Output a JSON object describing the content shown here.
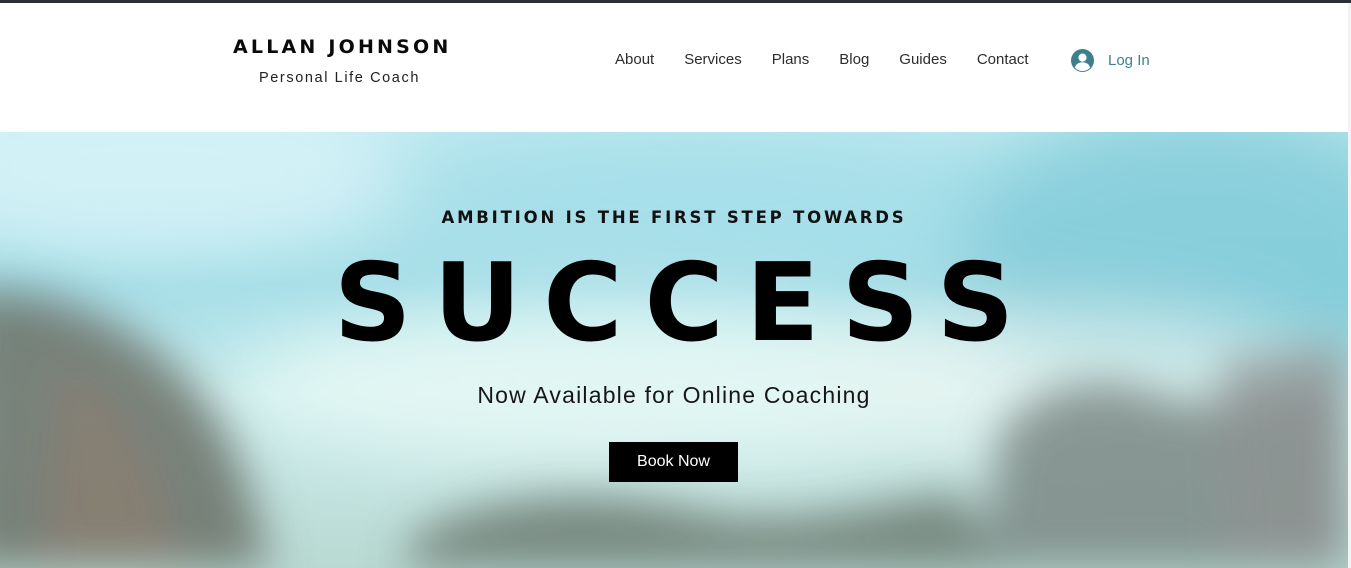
{
  "header": {
    "brand_name": "ALLAN JOHNSON",
    "brand_tagline": "Personal Life Coach"
  },
  "nav": {
    "items": [
      {
        "label": "About"
      },
      {
        "label": "Services"
      },
      {
        "label": "Plans"
      },
      {
        "label": "Blog"
      },
      {
        "label": "Guides"
      },
      {
        "label": "Contact"
      }
    ]
  },
  "login": {
    "label": "Log In",
    "icon": "user-avatar-icon"
  },
  "hero": {
    "eyebrow": "AMBITION IS THE FIRST STEP TOWARDS",
    "title": "SUCCESS",
    "subtitle": "Now Available for Online Coaching",
    "cta_label": "Book Now"
  },
  "colors": {
    "accent": "#3d7f8f",
    "button_bg": "#000000",
    "top_strip": "#2c3035"
  }
}
